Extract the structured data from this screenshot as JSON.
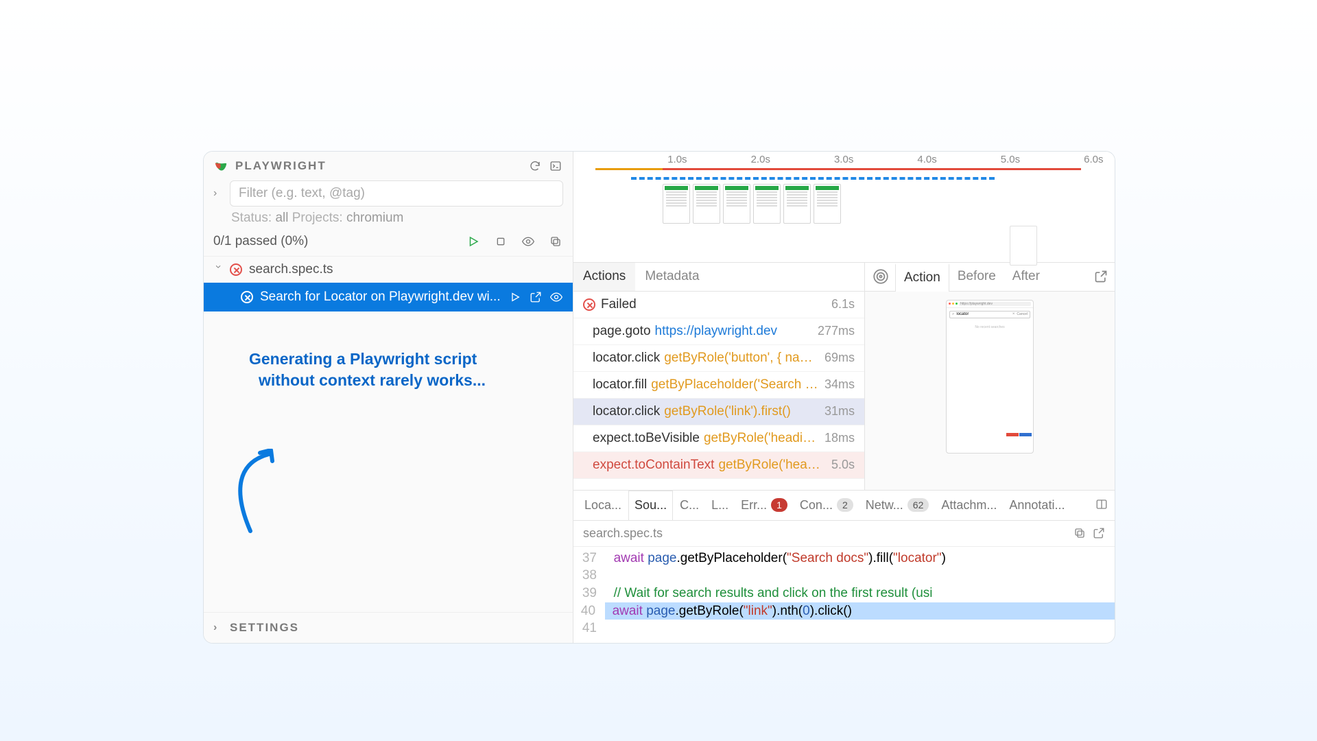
{
  "app": {
    "title": "PLAYWRIGHT",
    "settings_label": "SETTINGS"
  },
  "filter": {
    "placeholder": "Filter (e.g. text, @tag)",
    "status_label": "Status:",
    "status_value": "all",
    "projects_label": "Projects:",
    "projects_value": "chromium"
  },
  "results": {
    "summary": "0/1 passed (0%)"
  },
  "file": {
    "name": "search.spec.ts"
  },
  "test": {
    "name": "Search for Locator on Playwright.dev wi..."
  },
  "annotation": {
    "line1": "Generating a Playwright script",
    "line2": "without context rarely works..."
  },
  "timeline": {
    "ticks": [
      "1.0s",
      "2.0s",
      "3.0s",
      "4.0s",
      "5.0s",
      "6.0s"
    ]
  },
  "action_tabs": {
    "actions": "Actions",
    "metadata": "Metadata"
  },
  "preview_tabs": {
    "action": "Action",
    "before": "Before",
    "after": "After"
  },
  "failed": {
    "label": "Failed",
    "duration": "6.1s"
  },
  "actions": [
    {
      "method": "page.goto",
      "locator": "https://playwright.dev",
      "dur": "277ms",
      "kind": "link"
    },
    {
      "method": "locator.click",
      "locator": "getByRole('button', { nam...",
      "dur": "69ms",
      "kind": "loc"
    },
    {
      "method": "locator.fill",
      "locator": "getByPlaceholder('Search d...",
      "dur": "34ms",
      "kind": "loc"
    },
    {
      "method": "locator.click",
      "locator": "getByRole('link').first()",
      "dur": "31ms",
      "kind": "loc",
      "selected": true
    },
    {
      "method": "expect.toBeVisible",
      "locator": "getByRole('heading'...",
      "dur": "18ms",
      "kind": "loc"
    },
    {
      "method": "expect.toContainText",
      "locator": "getByRole('headin...",
      "dur": "5.0s",
      "kind": "loc",
      "error": true
    }
  ],
  "bottom_tabs": [
    {
      "label": "Loca..."
    },
    {
      "label": "Sou...",
      "active": true
    },
    {
      "label": "C..."
    },
    {
      "label": "L..."
    },
    {
      "label": "Err...",
      "badge": "1",
      "badge_color": "red"
    },
    {
      "label": "Con...",
      "badge": "2",
      "badge_color": "gray"
    },
    {
      "label": "Netw...",
      "badge": "62",
      "badge_color": "gray"
    },
    {
      "label": "Attachm..."
    },
    {
      "label": "Annotati..."
    }
  ],
  "source": {
    "filename": "search.spec.ts",
    "lines": [
      {
        "num": "37",
        "tokens": [
          {
            "t": "  ",
            "c": ""
          },
          {
            "t": "await",
            "c": "kw"
          },
          {
            "t": " ",
            "c": ""
          },
          {
            "t": "page",
            "c": "obj"
          },
          {
            "t": ".getByPlaceholder(",
            "c": ""
          },
          {
            "t": "\"Search docs\"",
            "c": "str"
          },
          {
            "t": ").fill(",
            "c": ""
          },
          {
            "t": "\"locator\"",
            "c": "str"
          },
          {
            "t": ")",
            "c": ""
          }
        ]
      },
      {
        "num": "38",
        "tokens": []
      },
      {
        "num": "39",
        "tokens": [
          {
            "t": "  ",
            "c": ""
          },
          {
            "t": "// Wait for search results and click on the first result (usi",
            "c": "cm"
          }
        ]
      },
      {
        "num": "40",
        "hl": true,
        "tokens": [
          {
            "t": "  ",
            "c": ""
          },
          {
            "t": "await",
            "c": "kw"
          },
          {
            "t": " ",
            "c": ""
          },
          {
            "t": "page",
            "c": "obj"
          },
          {
            "t": ".getByRole(",
            "c": ""
          },
          {
            "t": "\"link\"",
            "c": "str"
          },
          {
            "t": ").nth(",
            "c": ""
          },
          {
            "t": "0",
            "c": "obj"
          },
          {
            "t": ").click()",
            "c": ""
          }
        ]
      },
      {
        "num": "41",
        "tokens": []
      }
    ]
  },
  "mini_browser": {
    "url": "https://playwright.dev",
    "search_value": "locator",
    "cancel": "Cancel",
    "message": "No recent searches"
  }
}
